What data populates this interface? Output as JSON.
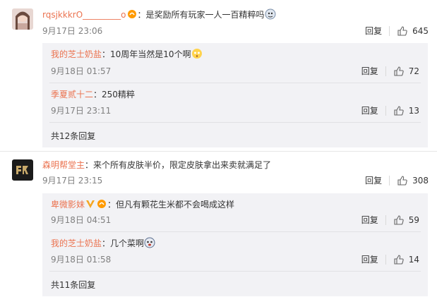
{
  "comments": [
    {
      "user": "rqsjkkkrO_________o",
      "text": "是奖励所有玩家一人一百精粹吗",
      "time": "9月17日 23:06",
      "reply_label": "回复",
      "likes": "645",
      "replies": [
        {
          "user": "我的芝士奶盐",
          "text": "10周年当然是10个啊",
          "time": "9月18日 01:57",
          "reply_label": "回复",
          "likes": "72"
        },
        {
          "user": "季夏贰十二",
          "text": "250精粹",
          "time": "9月17日 23:11",
          "reply_label": "回复",
          "likes": "13"
        }
      ],
      "more_replies": "共12条回复"
    },
    {
      "user": "森明帮堂主",
      "text": "来个所有皮肤半价，限定皮肤拿出来卖就满足了",
      "time": "9月17日 23:15",
      "reply_label": "回复",
      "likes": "308",
      "replies": [
        {
          "user": "卑微影妹",
          "text": "但凡有颗花生米都不会喝成这样",
          "time": "9月18日 04:51",
          "reply_label": "回复",
          "likes": "59"
        },
        {
          "user": "我的芝士奶盐",
          "text": "几个菜啊",
          "time": "9月18日 01:58",
          "reply_label": "回复",
          "likes": "14"
        }
      ],
      "more_replies": "共11条回复"
    }
  ],
  "colors": {
    "username": "#eb7350",
    "reply_bg": "#f2f2f5",
    "meta": "#808080"
  },
  "icons": {
    "like": "thumbs-up-icon",
    "vip_badge": "vip-badge-icon",
    "verified": "verified-v-icon",
    "emoji": "emoji-icon"
  }
}
